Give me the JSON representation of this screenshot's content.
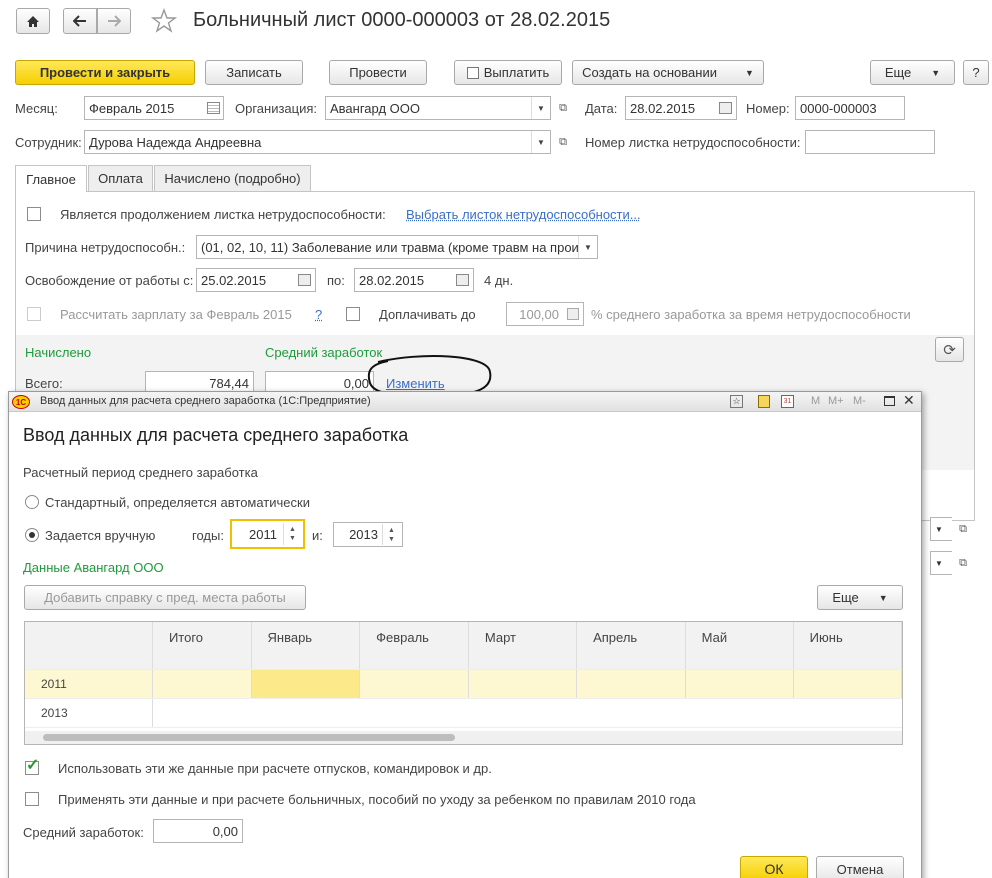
{
  "header": {
    "title": "Больничный лист 0000-000003 от 28.02.2015",
    "home_icon": "home-icon",
    "back_icon": "arrow-left-icon",
    "forward_icon": "arrow-right-icon",
    "star_icon": "star-icon"
  },
  "toolbar": {
    "post_close": "Провести и закрыть",
    "save": "Записать",
    "post": "Провести",
    "pay": "Выплатить",
    "create_based": "Создать на основании",
    "more": "Еще",
    "help": "?"
  },
  "form": {
    "month_label": "Месяц:",
    "month_value": "Февраль 2015",
    "org_label": "Организация:",
    "org_value": "Авангард ООО",
    "date_label": "Дата:",
    "date_value": "28.02.2015",
    "number_label": "Номер:",
    "number_value": "0000-000003",
    "employee_label": "Сотрудник:",
    "employee_value": "Дурова Надежда Андреевна",
    "sick_number_label": "Номер листка нетрудоспособности:",
    "sick_number_value": ""
  },
  "tabs": [
    {
      "label": "Главное"
    },
    {
      "label": "Оплата"
    },
    {
      "label": "Начислено (подробно)"
    }
  ],
  "main": {
    "continuation_label": "Является продолжением листка нетрудоспособности:",
    "choose_link": "Выбрать листок нетрудоспособности...",
    "reason_label": "Причина нетрудоспособн.:",
    "reason_value": "(01, 02, 10, 11) Заболевание или травма (кроме травм на прои:",
    "release_label": "Освобождение от работы с:",
    "release_from": "25.02.2015",
    "to_label": "по:",
    "release_to": "28.02.2015",
    "days": "4 дн.",
    "calc_salary_label": "Рассчитать зарплату за Февраль 2015",
    "question": "?",
    "pay_up_label": "Доплачивать до",
    "pay_up_value": "100,00",
    "pay_up_suffix": "% среднего заработка за время нетрудоспособности",
    "accrued_header": "Начислено",
    "avg_header": "Средний заработок",
    "total_label": "Всего:",
    "total_value": "784,44",
    "avg_value": "0,00",
    "change_link": "Изменить"
  },
  "dialog": {
    "window_title": "Ввод данных для расчета среднего заработка (1С:Предприятие)",
    "heading": "Ввод данных для расчета среднего заработка",
    "period_label": "Расчетный период среднего заработка",
    "standard_label": "Стандартный, определяется автоматически",
    "manual_label": "Задается вручную",
    "years_label": "годы:",
    "year_from": "2011",
    "and_label": "и:",
    "year_to": "2013",
    "data_header": "Данные Авангард ООО",
    "add_cert_button": "Добавить справку с пред. места работы",
    "more_button": "Еще",
    "table": {
      "columns": [
        "",
        "Итого",
        "Январь",
        "Февраль",
        "Март",
        "Апрель",
        "Май",
        "Июнь"
      ],
      "rows": [
        {
          "year": "2011"
        },
        {
          "year": "2013"
        }
      ]
    },
    "use_data_label": "Использовать эти же данные при расчете отпусков, командировок и др.",
    "apply_data_label": "Применять эти данные и при расчете больничных, пособий по уходу за ребенком по правилам 2010 года",
    "avg_label": "Средний заработок:",
    "avg_value": "0,00",
    "ok": "ОК",
    "cancel": "Отмена",
    "titlebar_buttons": [
      "M",
      "M+",
      "M-"
    ]
  },
  "colors": {
    "accent_yellow": "#f5cf00",
    "green": "#1e9b3c",
    "link": "#3b6ec8",
    "row_highlight": "#fdf8d2"
  }
}
